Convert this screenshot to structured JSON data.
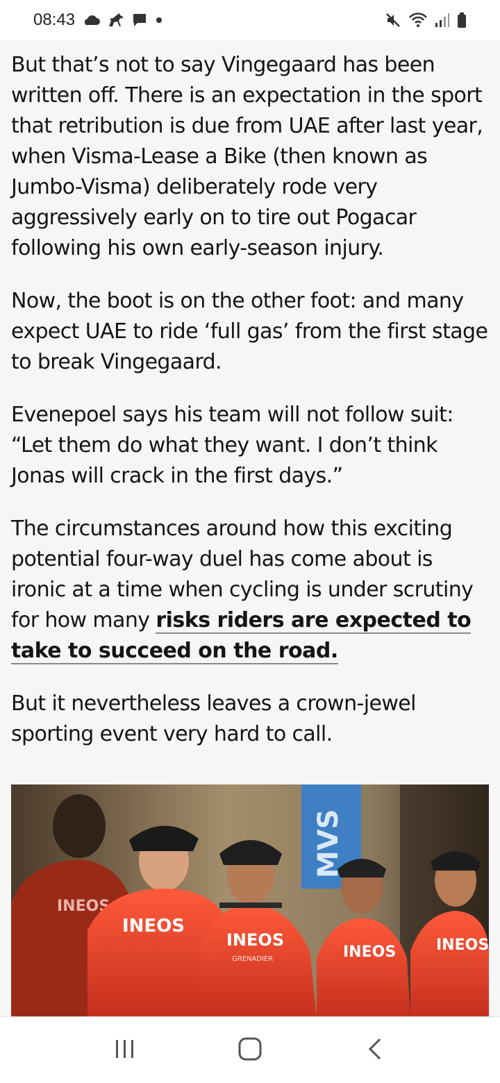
{
  "status_bar": {
    "time": "08:43",
    "left_icons": [
      "cloud-icon",
      "horse-icon",
      "chat-icon",
      "dot-icon"
    ],
    "right_icons": [
      "mute-icon",
      "wifi-icon",
      "signal-icon",
      "battery-icon"
    ]
  },
  "article": {
    "paragraphs": [
      "But that’s not to say Vingegaard has been written off. There is an expectation in the sport that retribution is due from UAE after last year, when Visma-Lease a Bike (then known as Jumbo-Visma) deliberately rode very aggressively early on to tire out Pogacar following his own early-season injury.",
      "Now, the boot is on the other foot: and many expect UAE to ride ‘full gas’ from the first stage to break Vingegaard.",
      "Evenepoel says his team will not follow suit: “Let them do what they want. I don’t think Jonas will crack in the first days.”",
      "But it nevertheless leaves a crown-jewel sporting event very hard to call."
    ],
    "linked_paragraph": {
      "before": "The circumstances around how this exciting potential four-way duel has come about is ironic at a time when cycling is under scrutiny for how many ",
      "link": "risks riders are expected to take to succeed on the road."
    },
    "photo": {
      "jersey_text": "INEOS",
      "jersey_subtext": "GRENADIER",
      "banner_text": "MVS"
    }
  },
  "nav_bar": {
    "buttons": [
      "recent-apps-icon",
      "home-icon",
      "back-icon"
    ]
  },
  "colors": {
    "background": "#f6f6f6",
    "text": "#141414",
    "jersey_red": "#e8402a"
  }
}
